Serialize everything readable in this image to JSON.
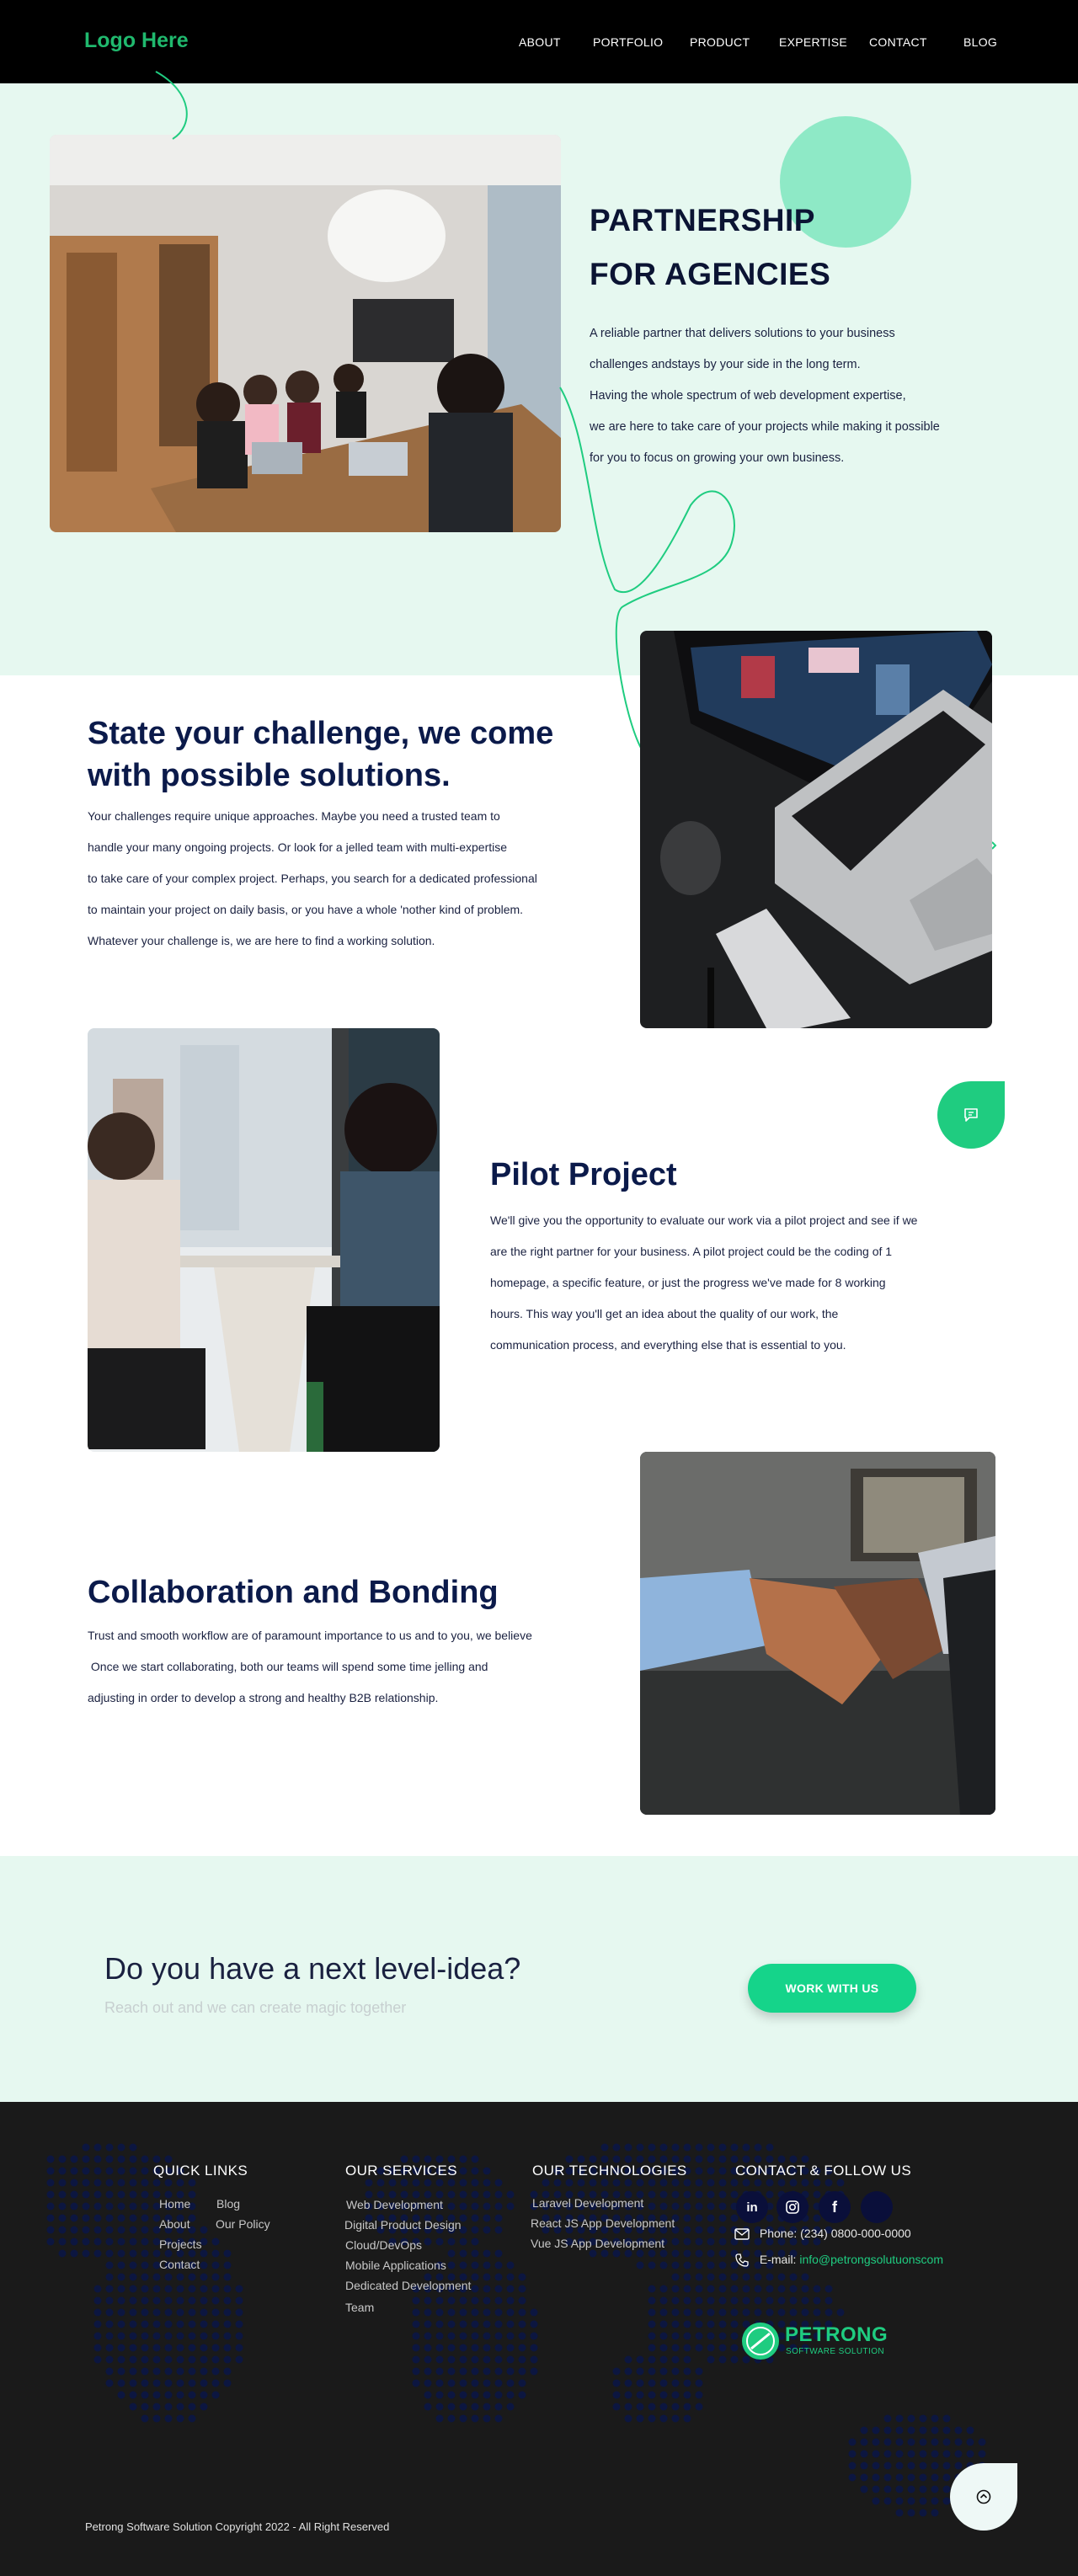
{
  "header": {
    "logo": "Logo Here",
    "nav": [
      "ABOUT",
      "PORTFOLIO",
      "PRODUCT",
      "EXPERTISE",
      "CONTACT",
      "BLOG"
    ]
  },
  "hero": {
    "title_line1": "PARTNERSHIP",
    "title_line2": "FOR AGENCIES",
    "body": [
      "A reliable partner that delivers solutions to your business",
      "challenges andstays by your side in the long term.",
      "Having the whole spectrum of web development expertise,",
      "we are here to take care of your projects while making it possible",
      "for you to focus on growing your own business."
    ]
  },
  "challenge": {
    "title_line1": "State your challenge, we come",
    "title_line2": "with possible solutions.",
    "body": [
      "Your challenges require unique approaches.  Maybe you need a trusted team to",
      "handle your many ongoing projects. Or look for a jelled team with multi-expertise",
      "to take care of your complex project. Perhaps, you search for a dedicated professional",
      "to maintain your project on daily basis, or you have a whole 'nother kind of problem.",
      "Whatever your challenge is, we are here to find a working solution."
    ]
  },
  "pilot": {
    "title": "Pilot Project",
    "body": [
      "We'll give you the opportunity to evaluate our work via a pilot project and see if we",
      "are the right partner for your business. A pilot project could be the coding of 1",
      "homepage, a specific feature, or just the progress we've made for 8 working",
      "hours. This way you'll get an idea about the quality of our work, the",
      "communication process, and everything else that is essential to you."
    ]
  },
  "collab": {
    "title": "Collaboration and Bonding",
    "body": [
      "Trust and smooth workflow are of paramount importance to us and to you, we believe",
      " Once we start collaborating, both our teams will spend some time jelling and",
      "adjusting in order to develop a strong and healthy B2B relationship."
    ]
  },
  "cta": {
    "title": "Do you have a next level-idea?",
    "subtitle": "Reach out and we can create magic together",
    "button": "WORK WITH US"
  },
  "footer": {
    "quick_links": {
      "heading": "QUICK LINKS",
      "col1": [
        "Home",
        "About",
        "Projects",
        "Contact"
      ],
      "col2": [
        "Blog",
        "Our Policy"
      ]
    },
    "services": {
      "heading": "OUR SERVICES",
      "items": [
        "Web Development",
        "Digital Product Design",
        "Cloud/DevOps",
        "Mobile Applications",
        "Dedicated Development",
        "Team"
      ]
    },
    "technologies": {
      "heading": "OUR TECHNOLOGIES",
      "items": [
        "Laravel Development",
        "React JS App Development",
        "Vue JS App Development"
      ]
    },
    "contact": {
      "heading": "CONTACT & FOLLOW US",
      "phone": "Phone: (234) 0800-000-0000",
      "email_label": "E-mail: ",
      "email": "info@petrongsolutuonscom"
    },
    "brand": {
      "name": "PETRONG",
      "tagline": "SOFTWARE SOLUTION"
    },
    "copyright": "Petrong Software Solution Copyright 2022  - All Right Reserved"
  },
  "colors": {
    "accent": "#1fcc80",
    "hero_bg": "#e6f8f0",
    "footer_bg": "#1a1a1a",
    "heading": "#0b1a4a"
  },
  "icons": [
    "linkedin-icon",
    "instagram-icon",
    "facebook-icon",
    "envelope-icon",
    "phone-icon",
    "chat-icon",
    "arrow-up-icon"
  ]
}
